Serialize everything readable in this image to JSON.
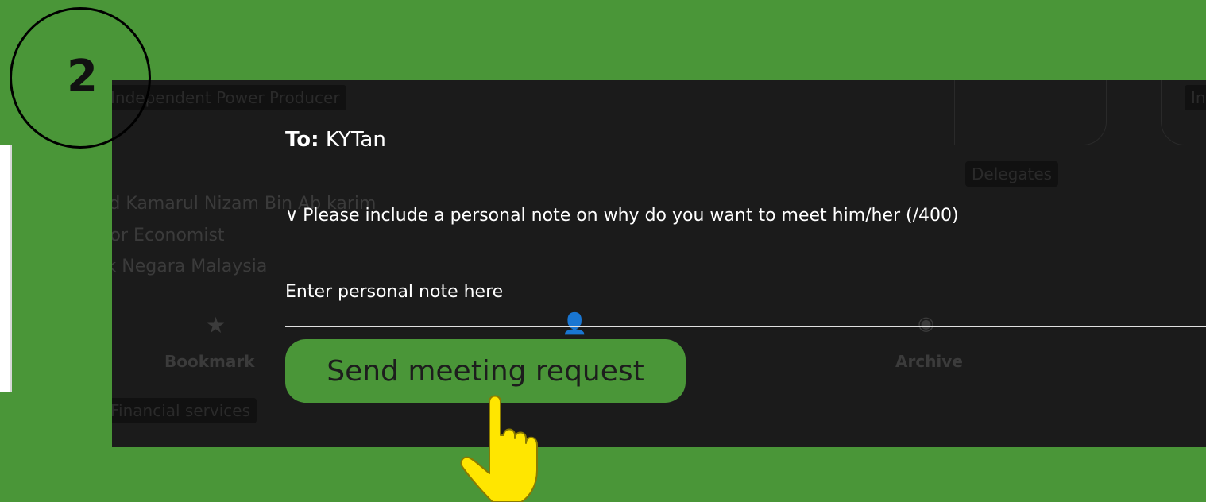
{
  "step": {
    "number": "2"
  },
  "background_card": {
    "tag_top": "Independent Power Producer",
    "tag_right": "In",
    "delegates_badge": "Delegates",
    "name": "Mohd Kamarul Nizam Bin Ab karim",
    "title": "Senior Economist",
    "org": "Bank Negara Malaysia",
    "bookmark_label": "Bookmark",
    "archive_label": "Archive",
    "tag_bottom": "Financial services"
  },
  "dialog": {
    "to_prefix": "To:",
    "to_name": "KYTan",
    "note_label": "Please include a personal note on why do you want to meet him/her (/400)",
    "note_placeholder": "Enter personal note here",
    "send_label": "Send meeting request"
  },
  "colors": {
    "accent": "#4a9638",
    "pointer": "#ffe600"
  },
  "icons": [
    "chevron-down-icon",
    "star-icon",
    "add-user-icon",
    "eye-off-icon",
    "pointing-hand-icon"
  ]
}
